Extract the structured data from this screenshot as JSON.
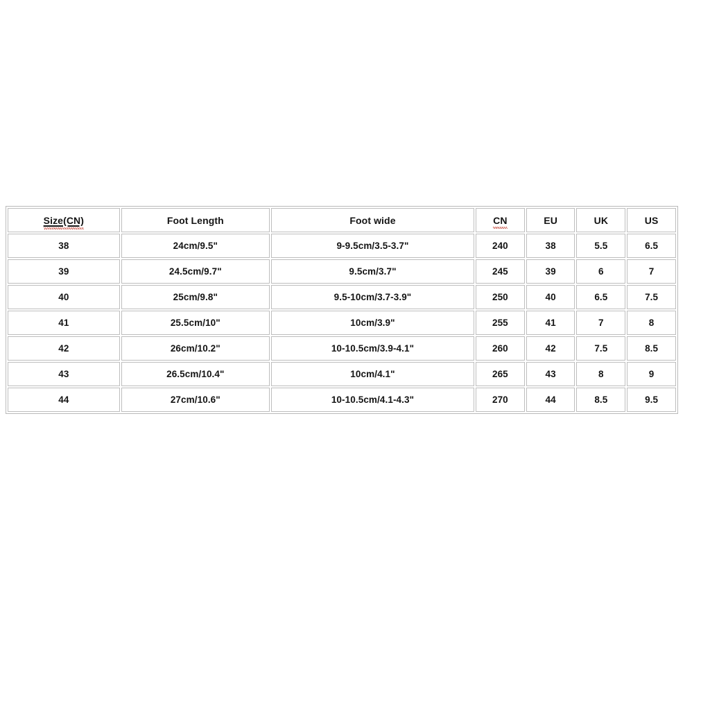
{
  "page": {
    "background_color": "#ffffff",
    "text_color": "#141414",
    "border_color": "#bdbdbd",
    "spellcheck_underline_color": "#c0392b"
  },
  "table": {
    "name": "shoe-size-conversion-chart",
    "columns": [
      {
        "key": "size_cn",
        "label": "Size(CN)",
        "underline": true,
        "spellcheck": true
      },
      {
        "key": "foot_length",
        "label": "Foot Length",
        "underline": false,
        "spellcheck": false
      },
      {
        "key": "foot_wide",
        "label": "Foot wide",
        "underline": false,
        "spellcheck": false
      },
      {
        "key": "cn",
        "label": "CN",
        "underline": false,
        "spellcheck": true
      },
      {
        "key": "eu",
        "label": "EU",
        "underline": false,
        "spellcheck": false
      },
      {
        "key": "uk",
        "label": "UK",
        "underline": false,
        "spellcheck": false
      },
      {
        "key": "us",
        "label": "US",
        "underline": false,
        "spellcheck": false
      }
    ],
    "rows": [
      {
        "size_cn": "38",
        "foot_length": "24cm/9.5\"",
        "foot_wide": "9-9.5cm/3.5-3.7\"",
        "cn": "240",
        "eu": "38",
        "uk": "5.5",
        "us": "6.5"
      },
      {
        "size_cn": "39",
        "foot_length": "24.5cm/9.7\"",
        "foot_wide": "9.5cm/3.7\"",
        "cn": "245",
        "eu": "39",
        "uk": "6",
        "us": "7"
      },
      {
        "size_cn": "40",
        "foot_length": "25cm/9.8\"",
        "foot_wide": "9.5-10cm/3.7-3.9\"",
        "cn": "250",
        "eu": "40",
        "uk": "6.5",
        "us": "7.5"
      },
      {
        "size_cn": "41",
        "foot_length": "25.5cm/10\"",
        "foot_wide": "10cm/3.9\"",
        "cn": "255",
        "eu": "41",
        "uk": "7",
        "us": "8"
      },
      {
        "size_cn": "42",
        "foot_length": "26cm/10.2\"",
        "foot_wide": "10-10.5cm/3.9-4.1\"",
        "cn": "260",
        "eu": "42",
        "uk": "7.5",
        "us": "8.5"
      },
      {
        "size_cn": "43",
        "foot_length": "26.5cm/10.4\"",
        "foot_wide": "10cm/4.1\"",
        "cn": "265",
        "eu": "43",
        "uk": "8",
        "us": "9"
      },
      {
        "size_cn": "44",
        "foot_length": "27cm/10.6\"",
        "foot_wide": "10-10.5cm/4.1-4.3\"",
        "cn": "270",
        "eu": "44",
        "uk": "8.5",
        "us": "9.5"
      }
    ]
  }
}
